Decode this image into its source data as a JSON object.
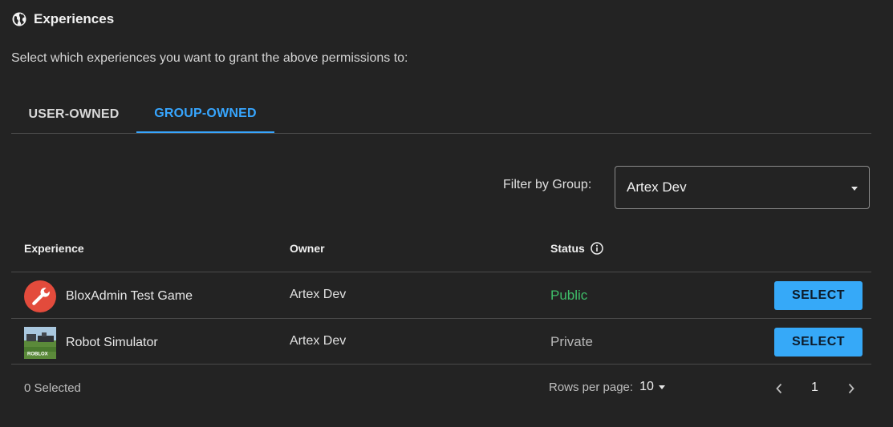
{
  "section": {
    "title": "Experiences",
    "icon": "globe-icon",
    "subtitle": "Select which experiences you want to grant the above permissions to:"
  },
  "tabs": [
    {
      "label": "USER-OWNED",
      "active": false
    },
    {
      "label": "GROUP-OWNED",
      "active": true
    }
  ],
  "filter": {
    "label": "Filter by Group:",
    "selected": "Artex Dev"
  },
  "table": {
    "columns": [
      "Experience",
      "Owner",
      "Status"
    ],
    "rows": [
      {
        "name": "BloxAdmin Test Game",
        "owner": "Artex Dev",
        "status": "Public",
        "icon": "bloxadmin-wrench-icon",
        "action": "SELECT"
      },
      {
        "name": "Robot Simulator",
        "owner": "Artex Dev",
        "status": "Private",
        "icon": "robot-simulator-thumbnail",
        "thumb_text": "ROBLOX",
        "action": "SELECT"
      }
    ]
  },
  "footer": {
    "selected": "0 Selected",
    "rows_per_page_label": "Rows per page:",
    "rows_per_page_value": "10",
    "page": "1"
  },
  "colors": {
    "background": "#232323",
    "accent": "#37a6ff",
    "button": "#36a9f8",
    "public": "#3fbf6a"
  }
}
